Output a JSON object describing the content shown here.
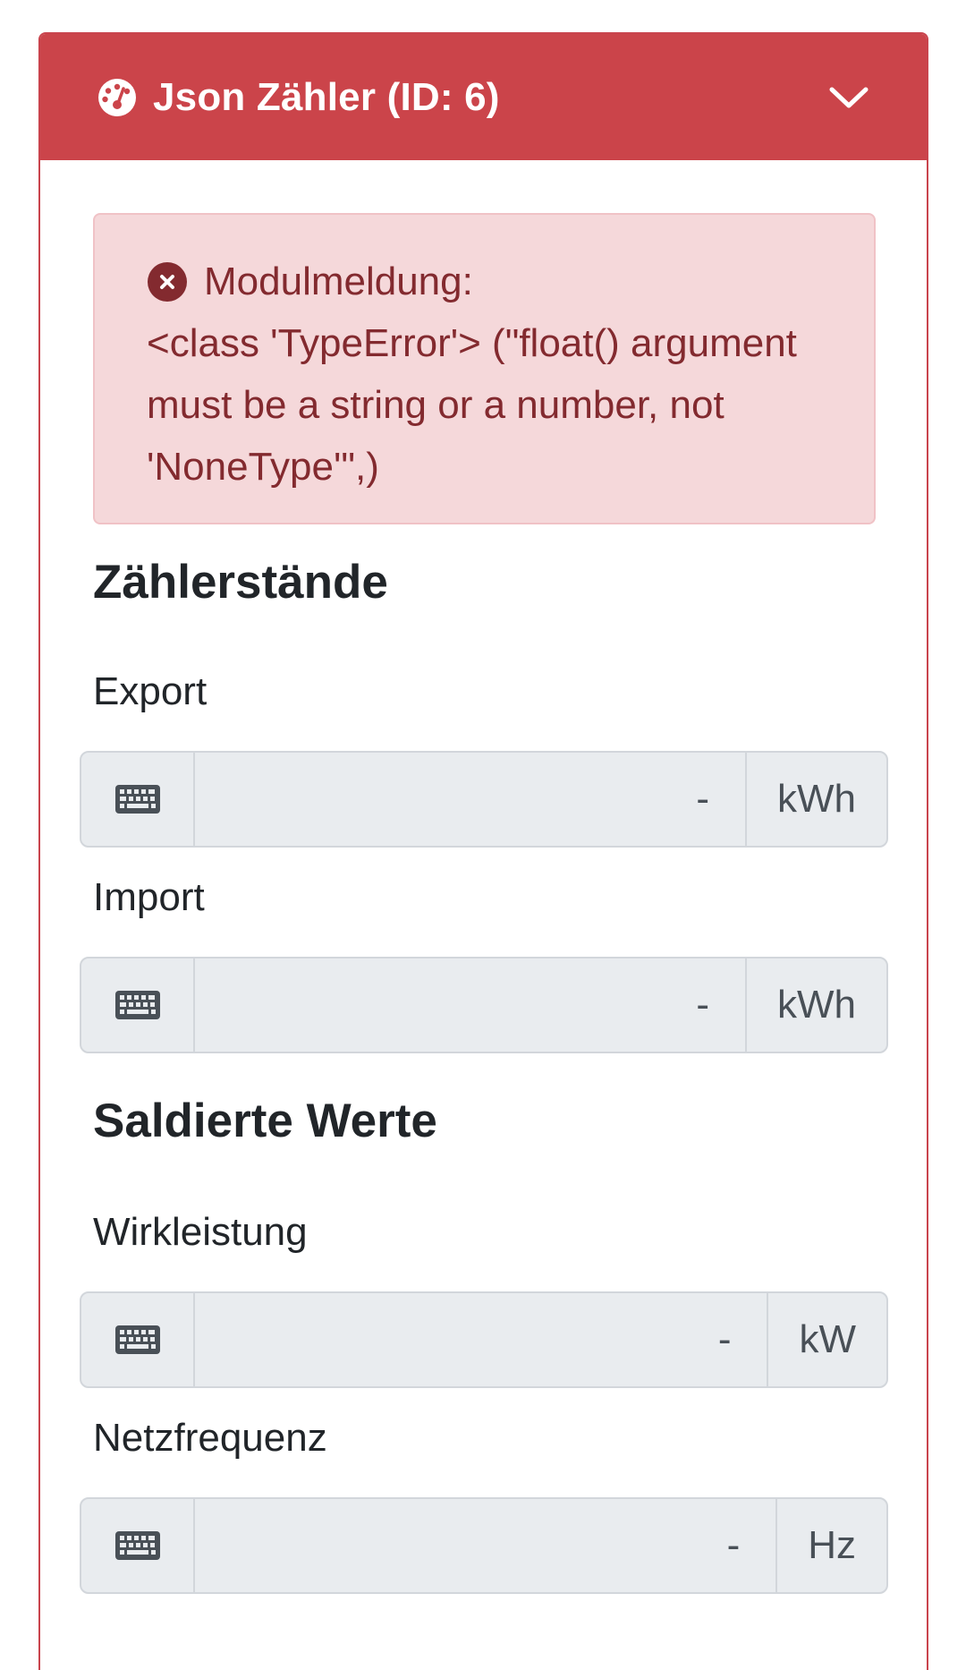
{
  "card": {
    "title": "Json Zähler (ID: 6)",
    "header_icon": "gauge-icon",
    "toggle_icon": "chevron-down-icon",
    "header_color": "#cb444a"
  },
  "alert": {
    "icon": "circle-x-icon",
    "title": "Modulmeldung:",
    "message": "<class 'TypeError'> (\"float() argument must be a string or a number, not 'NoneType'\",)",
    "background_color": "#f5d8da",
    "text_color": "#832a2f"
  },
  "sections": {
    "counters": {
      "heading": "Zählerstände",
      "export": {
        "label": "Export",
        "value": "-",
        "unit": "kWh",
        "icon": "keyboard-icon"
      },
      "import": {
        "label": "Import",
        "value": "-",
        "unit": "kWh",
        "icon": "keyboard-icon"
      }
    },
    "balanced": {
      "heading": "Saldierte Werte",
      "active_power": {
        "label": "Wirkleistung",
        "value": "-",
        "unit": "kW",
        "icon": "keyboard-icon"
      },
      "frequency": {
        "label": "Netzfrequenz",
        "value": "-",
        "unit": "Hz",
        "icon": "keyboard-icon"
      }
    }
  }
}
